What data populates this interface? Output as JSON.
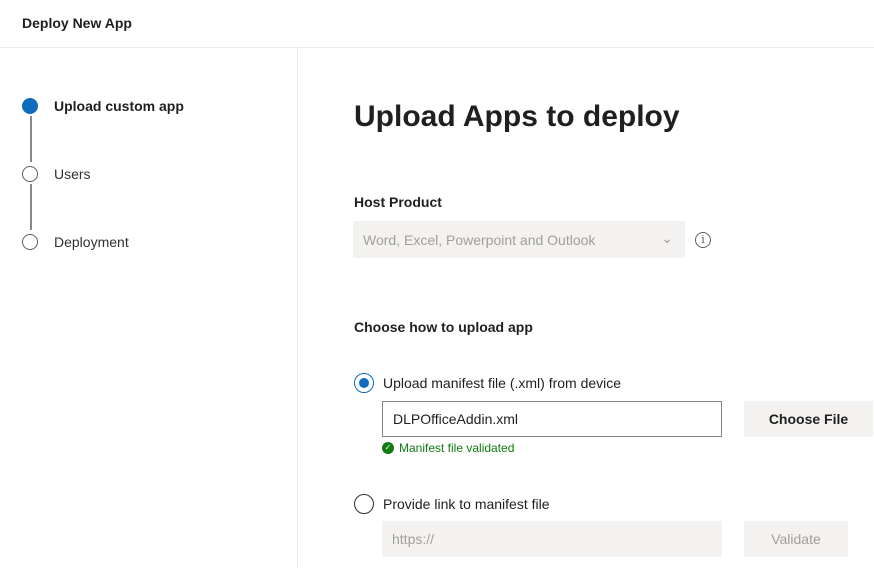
{
  "header": {
    "title": "Deploy New App"
  },
  "steps": [
    {
      "label": "Upload custom app",
      "active": true
    },
    {
      "label": "Users",
      "active": false
    },
    {
      "label": "Deployment",
      "active": false
    }
  ],
  "main": {
    "title": "Upload Apps to deploy",
    "host_product": {
      "label": "Host Product",
      "value": "Word, Excel, Powerpoint and Outlook",
      "info_glyph": "i"
    },
    "upload_method": {
      "label": "Choose how to upload app",
      "option_file": {
        "label": "Upload manifest file (.xml) from device",
        "selected": true,
        "file_value": "DLPOfficeAddin.xml",
        "choose_button": "Choose File",
        "status": "Manifest file validated"
      },
      "option_link": {
        "label": "Provide link to manifest file",
        "selected": false,
        "placeholder": "https://",
        "validate_button": "Validate"
      }
    }
  },
  "colors": {
    "accent": "#0f6cbd",
    "success": "#107c10",
    "disabled_bg": "#f3f2f1"
  }
}
